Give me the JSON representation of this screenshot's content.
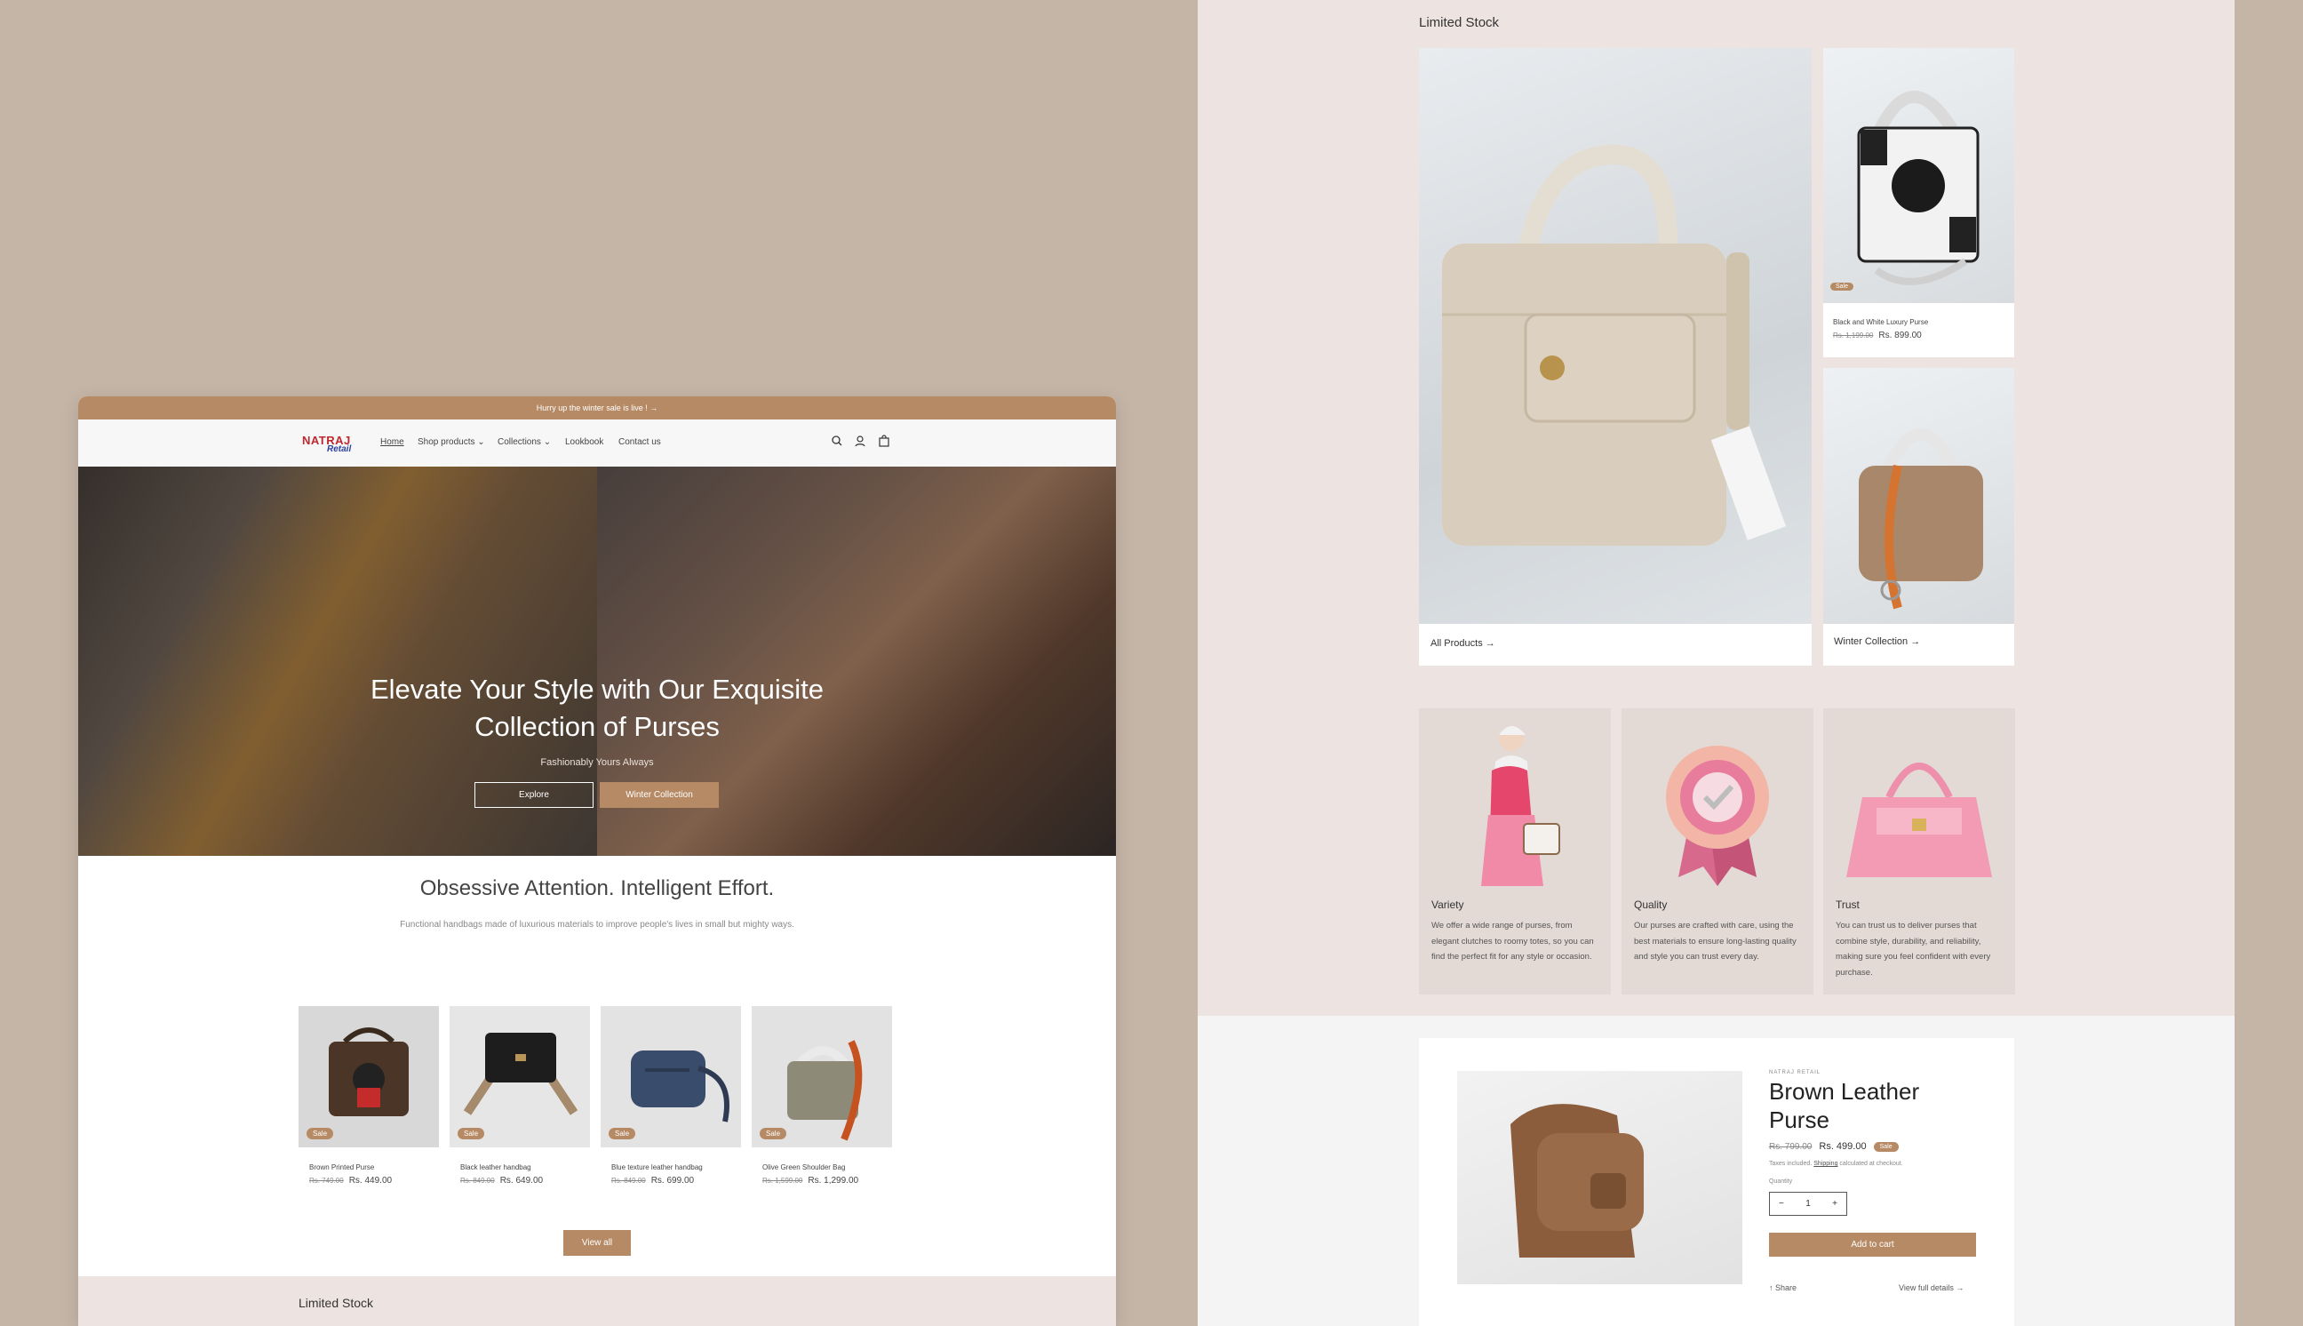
{
  "colors": {
    "accent": "#b68a64",
    "background": "#c5b5a7",
    "panel": "#ede4e1"
  },
  "announcement": "Hurry up the winter sale is live ! →",
  "logo": {
    "line1": "NATRAJ",
    "line2": "Retail"
  },
  "nav": {
    "home": "Home",
    "shop": "Shop products",
    "collections": "Collections",
    "lookbook": "Lookbook",
    "contact": "Contact us"
  },
  "header_icons": [
    "search-icon",
    "account-icon",
    "cart-icon"
  ],
  "hero": {
    "title": "Elevate Your Style with Our Exquisite Collection of Purses",
    "subtitle": "Fashionably Yours Always",
    "btn_explore": "Explore",
    "btn_winter": "Winter Collection"
  },
  "intro": {
    "title": "Obsessive Attention. Intelligent Effort.",
    "text": "Functional handbags made of luxurious materials to improve people's lives in small but mighty ways."
  },
  "products": [
    {
      "name": "Brown Printed Purse",
      "old_price": "Rs. 749.00",
      "price": "Rs. 449.00",
      "badge": "Sale"
    },
    {
      "name": "Black leather handbag",
      "old_price": "Rs. 849.00",
      "price": "Rs. 649.00",
      "badge": "Sale"
    },
    {
      "name": "Blue texture leather handbag",
      "old_price": "Rs. 849.00",
      "price": "Rs. 699.00",
      "badge": "Sale"
    },
    {
      "name": "Olive Green Shoulder Bag",
      "old_price": "Rs. 1,599.00",
      "price": "Rs. 1,299.00",
      "badge": "Sale"
    }
  ],
  "view_all": "View all",
  "limited_stock": "Limited Stock",
  "collage": {
    "feature_label": "All Products →",
    "card1": {
      "badge": "Sale",
      "name": "Black and White Luxury Purse",
      "old_price": "Rs. 1,199.00",
      "price": "Rs. 899.00"
    },
    "card2_label": "Winter Collection →"
  },
  "values": [
    {
      "title": "Variety",
      "text": "We offer a wide range of purses, from elegant clutches to roomy totes, so you can find the perfect fit for any style or occasion."
    },
    {
      "title": "Quality",
      "text": "Our purses are crafted with care, using the best materials to ensure long-lasting quality and style you can trust every day."
    },
    {
      "title": "Trust",
      "text": "You can trust us to deliver purses that combine style, durability, and reliability, making sure you feel confident with every purchase."
    }
  ],
  "pdp": {
    "vendor": "NATRAJ RETAIL",
    "title": "Brown Leather Purse",
    "old_price": "Rs. 799.00",
    "price": "Rs. 499.00",
    "sale": "Sale",
    "tax_prefix": "Taxes included.",
    "tax_link": "Shipping",
    "tax_suffix": "calculated at checkout.",
    "qty_label": "Quantity",
    "qty_minus": "−",
    "qty": "1",
    "qty_plus": "+",
    "add_to_cart": "Add to cart",
    "share": "↑ Share",
    "full_details": "View full details →"
  }
}
